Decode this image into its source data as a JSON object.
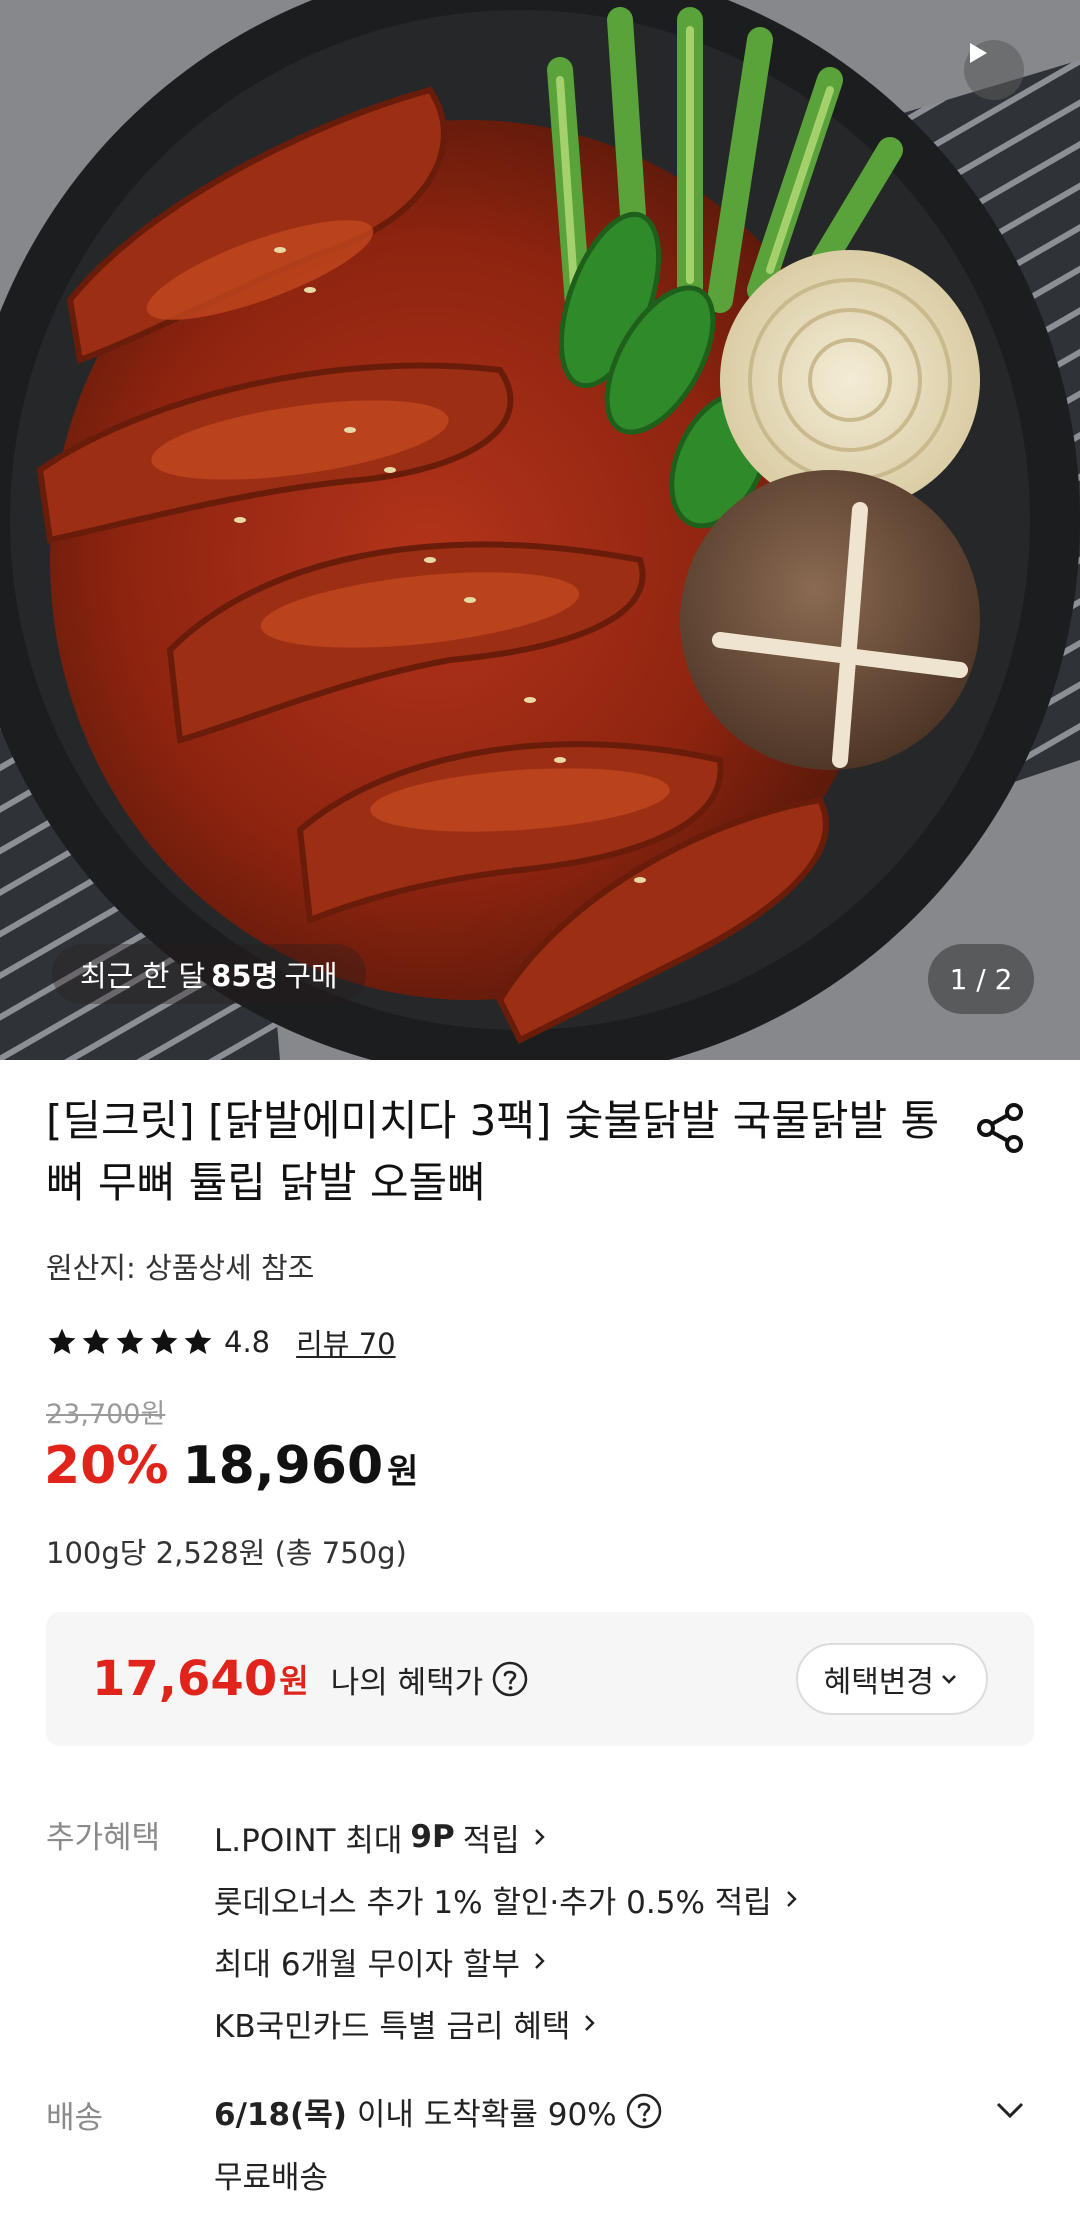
{
  "hero": {
    "buyers_prefix": "최근 한 달",
    "buyers_count": "85명",
    "buyers_suffix": "구매",
    "page_indicator": "1 / 2"
  },
  "product": {
    "title": "[딜크릿] [닭발에미치다 3팩] 숯불닭발 국물닭발 통뼈 무뼈 튤립 닭발 오돌뼈",
    "origin": "원산지: 상품상세 참조",
    "rating": "4.8",
    "rating_stars": 5,
    "review_link": "리뷰 70",
    "original_price": "23,700원",
    "discount_rate": "20%",
    "sale_price": "18,960",
    "currency": "원",
    "unit_price": "100g당 2,528원 (총 750g)"
  },
  "benefit_box": {
    "my_price": "17,640",
    "my_price_currency": "원",
    "label": "나의 혜택가",
    "change_button": "혜택변경"
  },
  "extra_benefits": {
    "label": "추가혜택",
    "items": [
      {
        "text": "L.POINT 최대",
        "bold": "9P",
        "suffix": "적립"
      },
      {
        "text": "롯데오너스 추가 1% 할인·추가 0.5% 적립"
      },
      {
        "text": "최대 6개월 무이자 할부"
      },
      {
        "text": "KB국민카드 특별 금리 혜택"
      }
    ]
  },
  "delivery": {
    "label": "배송",
    "date": "6/18(목)",
    "text": "이내 도착확률 90%",
    "sub": "무료배송"
  },
  "colors": {
    "accent_red": "#e0241b",
    "muted_gray": "#8a8a8a",
    "box_bg": "#f6f6f6"
  },
  "icons": [
    "play-icon",
    "share-icon",
    "star-icon",
    "help-icon",
    "chevron-down-icon",
    "chevron-right-icon"
  ]
}
